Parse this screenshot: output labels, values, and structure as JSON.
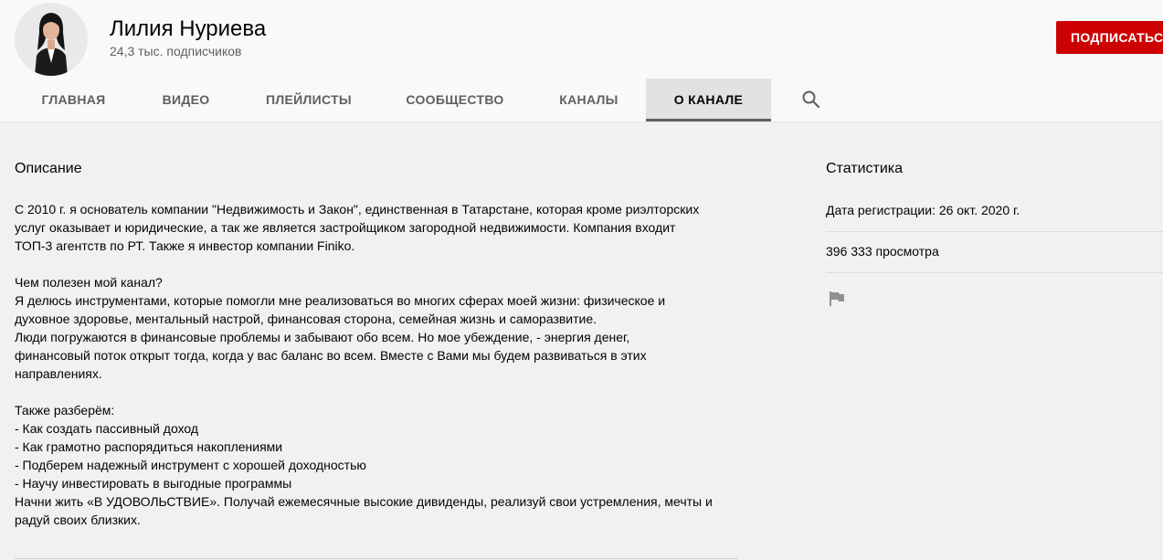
{
  "channel": {
    "name": "Лилия Нуриева",
    "subscribers": "24,3 тыс. подписчиков",
    "subscribe_label": "ПОДПИСАТЬСЯ"
  },
  "tabs": [
    {
      "label": "ГЛАВНАЯ"
    },
    {
      "label": "ВИДЕО"
    },
    {
      "label": "ПЛЕЙЛИСТЫ"
    },
    {
      "label": "СООБЩЕСТВО"
    },
    {
      "label": "КАНАЛЫ"
    },
    {
      "label": "О КАНАЛЕ",
      "active": true
    }
  ],
  "search_icon": "search-icon",
  "description": {
    "title": "Описание",
    "lines": [
      "С 2010 г. я основатель компании \"Недвижимость и Закон\", единственная в Татарстане, которая кроме риэлторских",
      "услуг оказывает и юридические, а так же является застройщиком загородной недвижимости. Компания входит",
      "ТОП-3 агентств по РТ. Также я инвестор компании Finiko.",
      "",
      "Чем полезен мой канал?",
      "Я делюсь инструментами, которые помогли мне реализоваться во многих сферах моей жизни: физическое и",
      "духовное здоровье, ментальный настрой, финансовая сторона, семейная жизнь и саморазвитие.",
      "Люди погружаются в финансовые проблемы и забывают обо всем. Но мое убеждение, - энергия денег,",
      "финансовый поток открыт тогда, когда у вас баланс во всем. Вместе с Вами мы будем развиваться в этих",
      "направлениях.",
      "",
      "Также разберём:",
      "- Как создать пассивный доход",
      "- Как грамотно распорядиться накоплениями",
      "- Подберем надежный инструмент с хорошей доходностью",
      "- Научу инвестировать в выгодные программы",
      "Начни жить «В УДОВОЛЬСТВИЕ». Получай ежемесячные высокие дивиденды, реализуй свои устремления, мечты и",
      "радуй своих близких."
    ]
  },
  "stats": {
    "title": "Статистика",
    "registration": "Дата регистрации: 26 окт. 2020 г.",
    "views": "396 333 просмотра",
    "report_icon": "flag-icon"
  },
  "colors": {
    "accent": "#cc0000",
    "page_bg": "#f1f1f1",
    "header_bg": "#f9f9f9"
  }
}
